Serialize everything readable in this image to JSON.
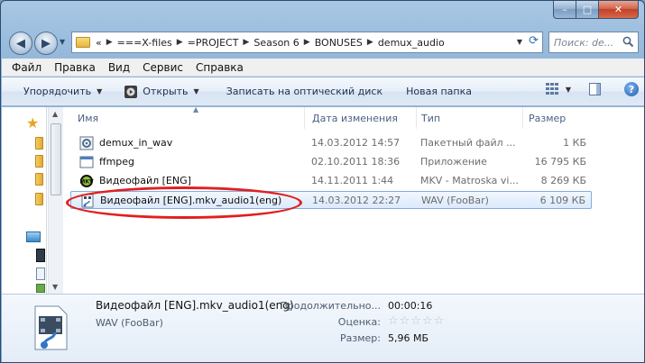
{
  "window": {
    "caption": {
      "minimize": "–",
      "maximize": "□",
      "close": "✕"
    }
  },
  "nav": {
    "back_icon": "◀",
    "forward_icon": "▶",
    "breadcrumb_overflow": "«",
    "breadcrumbs": [
      "===X-files",
      "=PROJECT",
      "Season 6",
      "BONUSES",
      "demux_audio"
    ],
    "search_placeholder": "Поиск: de..."
  },
  "menu": [
    "Файл",
    "Правка",
    "Вид",
    "Сервис",
    "Справка"
  ],
  "toolbar": {
    "organize": "Упорядочить",
    "open": "Открыть",
    "burn": "Записать на оптический диск",
    "new_folder": "Новая папка"
  },
  "columns": {
    "name": "Имя",
    "date": "Дата изменения",
    "type": "Тип",
    "size": "Размер"
  },
  "files": [
    {
      "icon": "batch-file-icon",
      "name": "demux_in_wav",
      "date": "14.03.2012 14:57",
      "type": "Пакетный файл ...",
      "size": "1 КБ",
      "selected": false
    },
    {
      "icon": "application-icon",
      "name": "ffmpeg",
      "date": "02.10.2011 18:36",
      "type": "Приложение",
      "size": "16 795 КБ",
      "selected": false
    },
    {
      "icon": "mkv-video-icon",
      "name": "Видеофайл [ENG]",
      "date": "14.11.2011 1:44",
      "type": "MKV - Matroska vi...",
      "size": "8 269 КБ",
      "selected": false
    },
    {
      "icon": "wav-audio-icon",
      "name": "Видеофайл [ENG].mkv_audio1(eng)",
      "date": "14.03.2012 22:27",
      "type": "WAV (FooBar)",
      "size": "6 109 КБ",
      "selected": true
    }
  ],
  "details": {
    "name": "Видеофайл [ENG].mkv_audio1(eng)",
    "type": "WAV (FooBar)",
    "duration_label": "Продолжительно...",
    "duration": "00:00:16",
    "rating_label": "Оценка:",
    "rating": "☆☆☆☆☆",
    "size_label": "Размер:",
    "size": "5,96 МБ"
  },
  "colors": {
    "highlight_ellipse": "#e02020",
    "selection": "#dbeafc"
  }
}
